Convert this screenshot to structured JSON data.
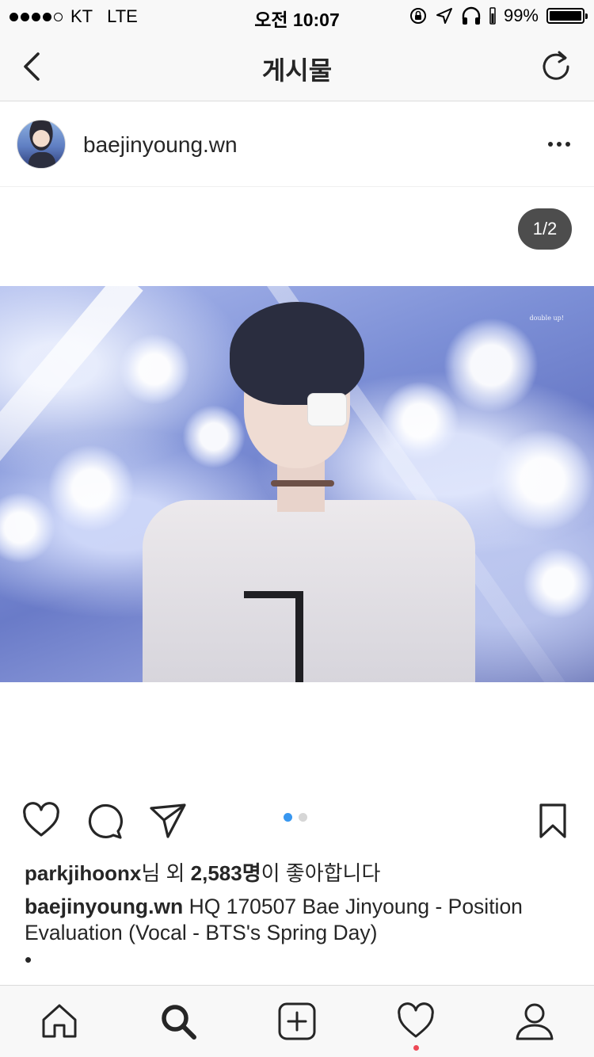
{
  "status_bar": {
    "carrier": "KT",
    "network": "LTE",
    "time": "오전 10:07",
    "battery": "99%",
    "battery_level": 0.99
  },
  "nav": {
    "title": "게시물",
    "back_icon": "chevron-left-icon",
    "refresh_icon": "refresh-icon"
  },
  "post": {
    "username": "baejinyoung.wn",
    "counter": "1/2",
    "watermark": "double up!",
    "likes": {
      "first_user": "parkjihoonx",
      "text_mid": "님 외 ",
      "count": "2,583명",
      "text_end": "이 좋아합니다"
    },
    "caption": {
      "username": "baejinyoung.wn",
      "text": " HQ 170507 Bae Jinyoung - Position Evaluation (Vocal - BTS's Spring Day)"
    },
    "caption_more": "•"
  },
  "actions": {
    "like_icon": "heart-outline-icon",
    "comment_icon": "comment-bubble-icon",
    "share_icon": "paper-plane-icon",
    "save_icon": "bookmark-icon",
    "carousel_page": 1,
    "carousel_total": 2
  },
  "tab_bar": {
    "items": [
      "home-icon",
      "search-icon",
      "create-icon",
      "heart-icon",
      "profile-icon"
    ],
    "active": "search-icon",
    "notification": true
  },
  "colors": {
    "accent": "#3897f0",
    "notification": "#ed4956",
    "text": "#262626"
  }
}
